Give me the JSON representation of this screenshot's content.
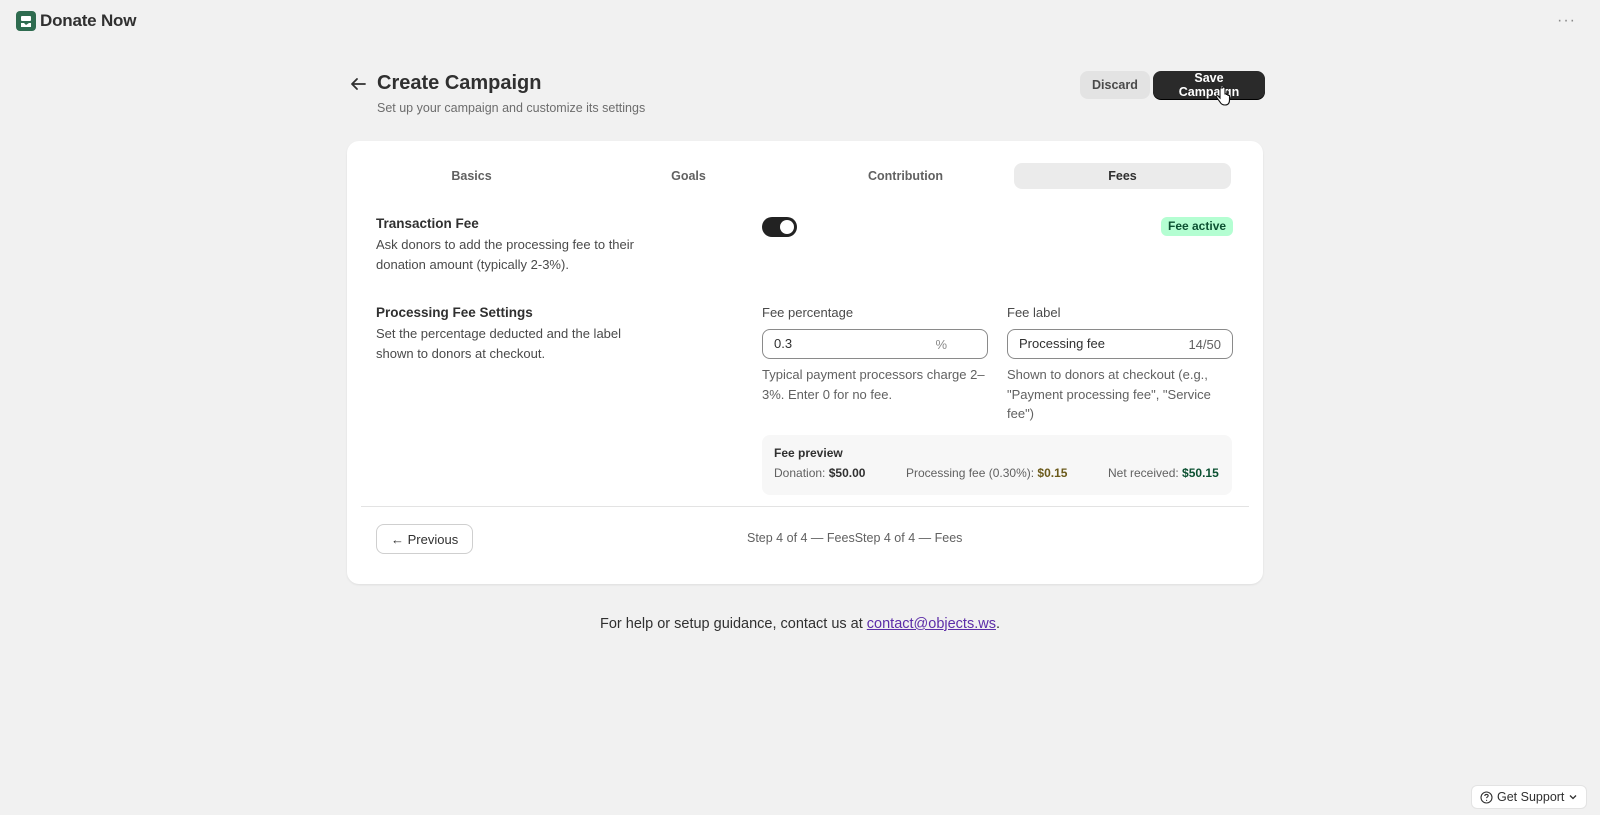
{
  "app": {
    "title": "Donate Now"
  },
  "header": {
    "title": "Create Campaign",
    "subtitle": "Set up your campaign and customize its settings",
    "discard_label": "Discard",
    "save_label": "Save Campaign"
  },
  "tabs": [
    {
      "label": "Basics",
      "active": false
    },
    {
      "label": "Goals",
      "active": false
    },
    {
      "label": "Contribution",
      "active": false
    },
    {
      "label": "Fees",
      "active": true
    }
  ],
  "transaction_fee": {
    "title": "Transaction Fee",
    "description": "Ask donors to add the processing fee to their donation amount (typically 2-3%).",
    "toggle_on": true,
    "badge": "Fee active"
  },
  "processing": {
    "title": "Processing Fee Settings",
    "description": "Set the percentage deducted and the label shown to donors at checkout.",
    "fee_percentage": {
      "label": "Fee percentage",
      "value": "0.3",
      "suffix": "%",
      "help": "Typical payment processors charge 2–3%. Enter 0 for no fee."
    },
    "fee_label": {
      "label": "Fee label",
      "value": "Processing fee",
      "count": "14/50",
      "help": "Shown to donors at checkout (e.g., \"Payment processing fee\", \"Service fee\")"
    }
  },
  "preview": {
    "title": "Fee preview",
    "donation_label": "Donation:",
    "donation_value": "$50.00",
    "fee_label": "Processing fee (0.30%):",
    "fee_value": "$0.15",
    "net_label": "Net received:",
    "net_value": "$50.15"
  },
  "footer_nav": {
    "previous_label": "← Previous",
    "step_text": "Step 4 of 4 — FeesStep 4 of 4 — Fees"
  },
  "help": {
    "prefix": "For help or setup guidance, contact us at ",
    "email": "contact@objects.ws",
    "suffix": "."
  },
  "support": {
    "label": "Get Support"
  },
  "colors": {
    "brand": "#2e6b4f",
    "primary_button": "#2a2a2a",
    "badge_bg": "#b4fed2",
    "link": "#5c2da8"
  }
}
